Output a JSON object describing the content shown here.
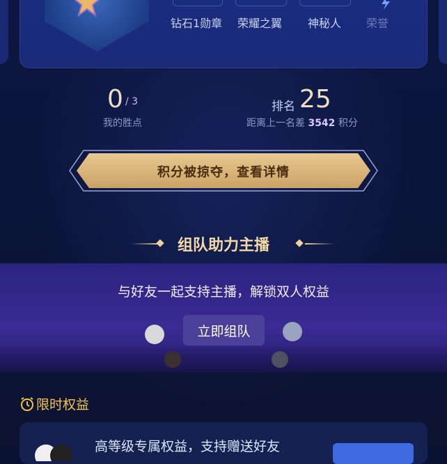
{
  "medals": {
    "items": [
      {
        "label": "钻石1勋章"
      },
      {
        "label": "荣耀之翼"
      },
      {
        "label": "神秘人"
      },
      {
        "label": "荣誉"
      }
    ]
  },
  "stats": {
    "wins_value": "0",
    "wins_total": "/ 3",
    "wins_label": "我的胜点",
    "rank_label": "排名",
    "rank_value": "25",
    "gap_prefix": "距离上一名差",
    "gap_value": "3542",
    "gap_suffix": "积分"
  },
  "banner": {
    "text": "积分被掠夺，查看详情"
  },
  "team": {
    "title": "组队助力主播",
    "subtitle": "与好友一起支持主播，解锁双人权益",
    "button": "立即组队"
  },
  "limited": {
    "title": "限时权益",
    "card_text": "高等级专属权益，支持赠送好友"
  },
  "colors": {
    "accent_gold": "#f2d9a6",
    "bg": "#0a1233",
    "limit_yellow": "#f4c44a",
    "button_blue": "#3f6ae0"
  }
}
